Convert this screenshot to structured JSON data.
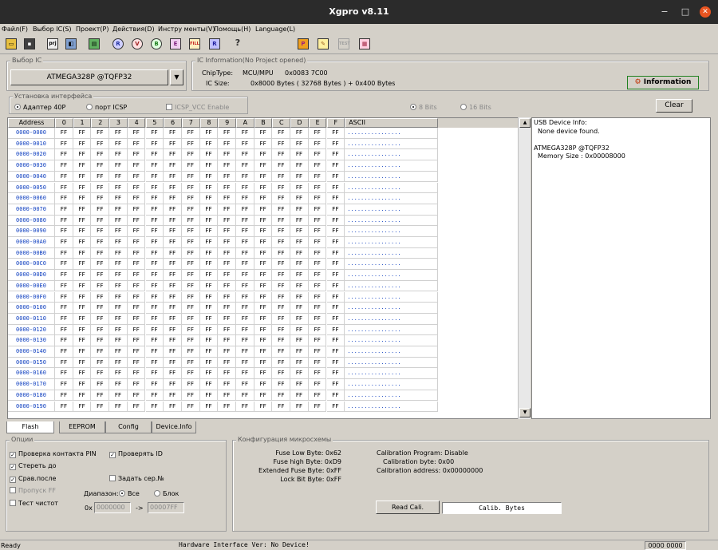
{
  "window": {
    "title": "Xgpro v8.11",
    "min": "−",
    "max": "□",
    "close": "✕"
  },
  "menu": [
    "Файл(F)",
    "Выбор IC(S)",
    "Проект(P)",
    "Действия(D)",
    "Инстру менты(V)",
    "Помощь(H)",
    "Language(L)"
  ],
  "toolbar": {
    "prj": "prj"
  },
  "ic_select": {
    "group": "Выбор IC",
    "value": "ATMEGA328P @TQFP32"
  },
  "ic_info": {
    "group": "IC Information(No Project opened)",
    "chip_type_label": "ChipType:",
    "chip_type_value": "MCU/MPU",
    "chip_id": "0x0083 7C00",
    "ic_size_label": "IC Size:",
    "ic_size_value": "0x8000 Bytes ( 32768 Bytes ) + 0x400 Bytes",
    "information_button": "Information"
  },
  "interface": {
    "group": "Установка интерфейса",
    "adapter": "Адаптер 40P",
    "icsp_port": "порт ICSP",
    "icsp_vcc": "ICSP_VCC Enable",
    "bits8": "8 Bits",
    "bits16": "16 Bits",
    "clear": "Clear"
  },
  "hex": {
    "headers": [
      "Address",
      "0",
      "1",
      "2",
      "3",
      "4",
      "5",
      "6",
      "7",
      "8",
      "9",
      "A",
      "B",
      "C",
      "D",
      "E",
      "F",
      "ASCII"
    ],
    "addresses": [
      "0000-0000",
      "0000-0010",
      "0000-0020",
      "0000-0030",
      "0000-0040",
      "0000-0050",
      "0000-0060",
      "0000-0070",
      "0000-0080",
      "0000-0090",
      "0000-00A0",
      "0000-00B0",
      "0000-00C0",
      "0000-00D0",
      "0000-00E0",
      "0000-00F0",
      "0000-0100",
      "0000-0110",
      "0000-0120",
      "0000-0130",
      "0000-0140",
      "0000-0150",
      "0000-0160",
      "0000-0170",
      "0000-0180",
      "0000-0190"
    ],
    "byte": "FF",
    "ascii": "................"
  },
  "info_panel": {
    "l1": "USB Device Info:",
    "l2": "None device found.",
    "l3": "",
    "l4": "ATMEGA328P @TQFP32",
    "l5": "Memory Size : 0x00008000"
  },
  "tabs": [
    "Flash",
    "EEPROM",
    "Config",
    "Device.Info"
  ],
  "options": {
    "group": "Опции",
    "check_pin": "Проверка контакта PIN",
    "verify_id": "Проверять ID",
    "erase_before": "Стереть до",
    "compare_after": "Срав.после",
    "set_serial": "Задать сер.№",
    "skip_ff": "Пропуск FF",
    "blank_check": "Тест чистот",
    "range_label": "Диапазон:",
    "range_all": "Все",
    "range_block": "Блок",
    "from_prefix": "0x",
    "from_value": "0000000",
    "arrow": "->",
    "to_value": "00007FF"
  },
  "config": {
    "group": "Конфигурация микросхемы",
    "fuse_low": "Fuse Low Byte: 0x62",
    "fuse_high": "Fuse high Byte: 0xD9",
    "fuse_ext": "Extended Fuse Byte: 0xFF",
    "lock": "Lock Bit Byte: 0xFF",
    "cal_prog": "Calibration Program: Disable",
    "cal_byte": "Calibration byte: 0x00",
    "cal_addr": "Calibration address: 0x00000000",
    "read_cali": "Read Cali.",
    "calib_bytes": "Calib. Bytes"
  },
  "status": {
    "left": "Ready",
    "center": "Hardware Interface Ver: No Device!",
    "right": "0000 0000"
  }
}
